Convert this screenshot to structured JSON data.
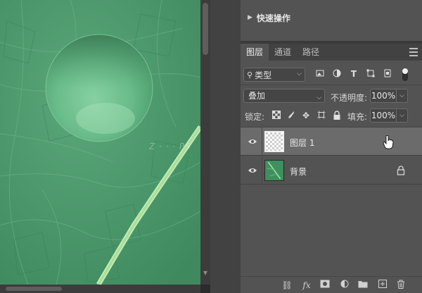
{
  "quick_actions": {
    "title": "快速操作"
  },
  "layers_panel": {
    "tabs": [
      {
        "label": "图层",
        "active": true
      },
      {
        "label": "通道",
        "active": false
      },
      {
        "label": "路径",
        "active": false
      }
    ],
    "filter": {
      "kind_label": "类型",
      "icons": [
        "image-filter-icon",
        "adjustment-filter-icon",
        "type-filter-icon",
        "shape-filter-icon",
        "smart-object-filter-icon"
      ]
    },
    "blend_mode": "叠加",
    "opacity_label": "不透明度:",
    "opacity_value": "100%",
    "lock_label": "锁定:",
    "fill_label": "填充:",
    "fill_value": "100%",
    "layers": [
      {
        "name": "图层 1",
        "selected": true,
        "visible": true,
        "locked": false
      },
      {
        "name": "背景",
        "selected": false,
        "visible": true,
        "locked": true
      }
    ],
    "bottom_icons": [
      "link-icon",
      "fx-icon",
      "mask-icon",
      "adjustment-icon",
      "group-folder-icon",
      "new-layer-icon",
      "trash-icon"
    ],
    "fx_label": "fx"
  },
  "colors": {
    "panel_bg": "#535353",
    "selected_layer": "#6b6b6b",
    "leaf_green": "#4f9b6f"
  }
}
